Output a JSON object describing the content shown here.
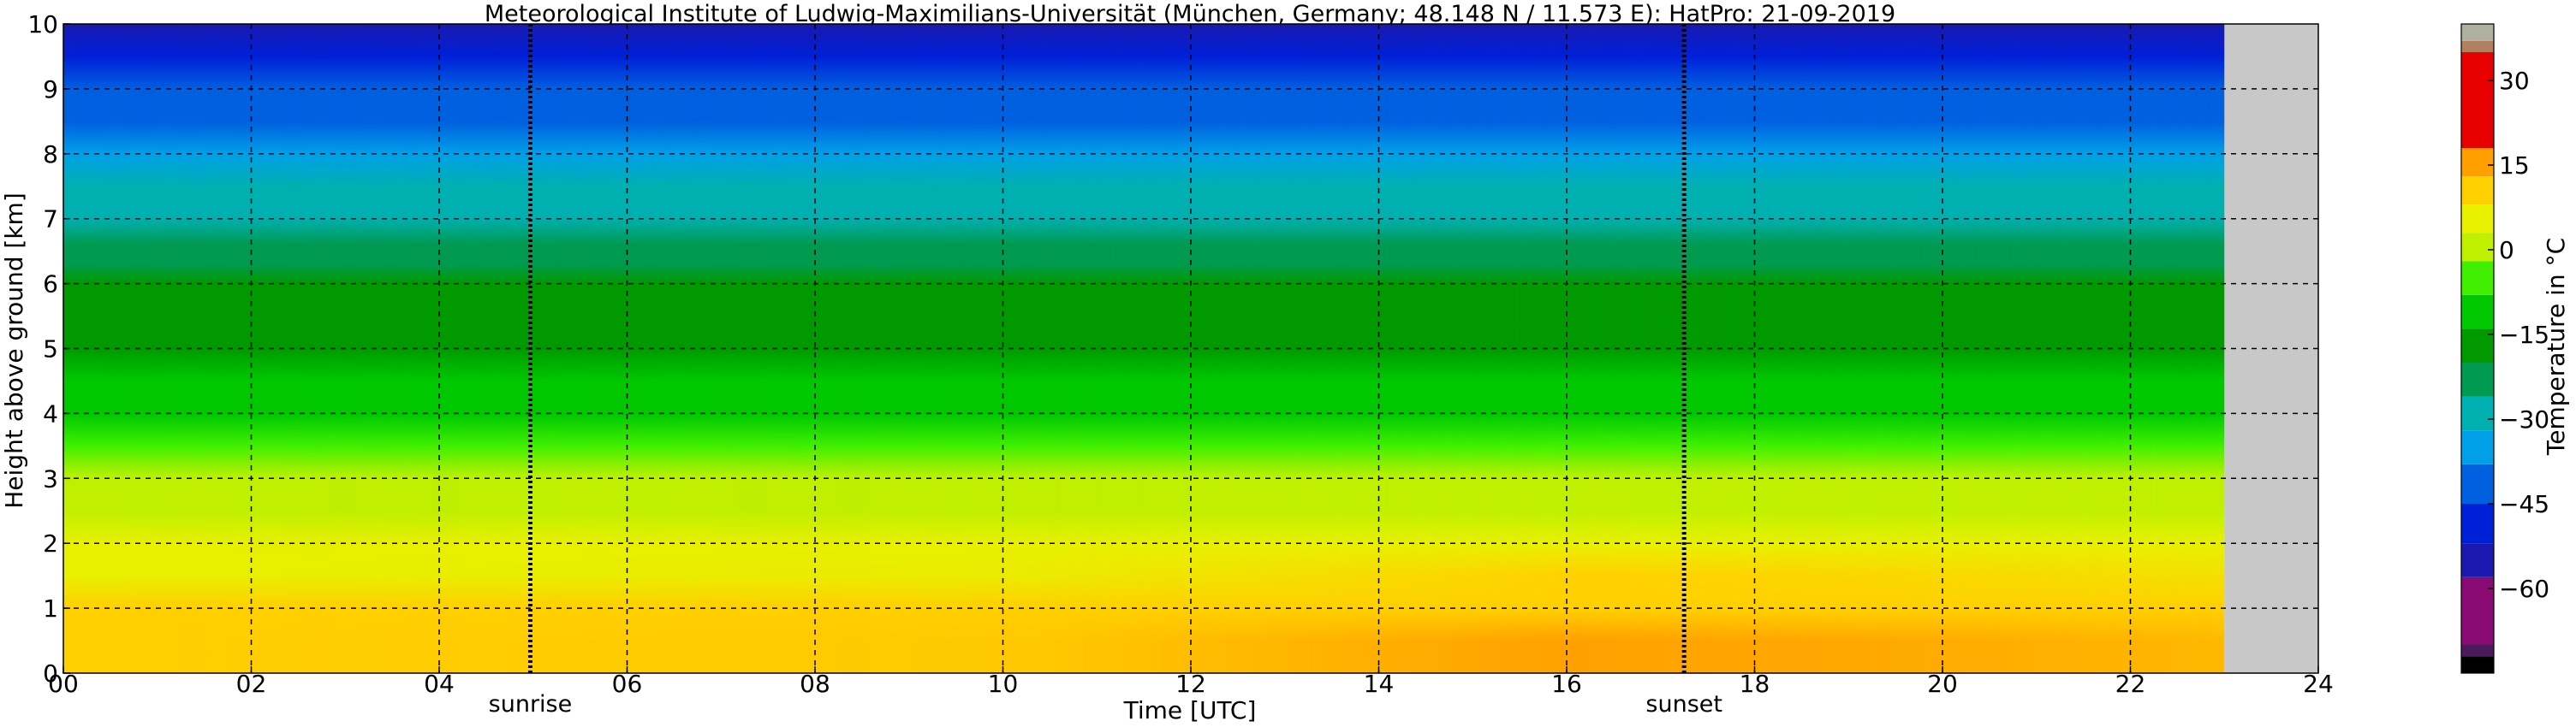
{
  "chart_data": {
    "type": "heatmap",
    "title": "Meteorological Institute of Ludwig-Maximilians-Universität (München, Germany; 48.148 N / 11.573 E):    HatPro: 21-09-2019",
    "xlabel": "Time [UTC]",
    "ylabel": "Height above ground [km]",
    "xlim": [
      0,
      24
    ],
    "ylim": [
      0,
      10
    ],
    "x_ticks": [
      "00",
      "02",
      "04",
      "06",
      "08",
      "10",
      "12",
      "14",
      "16",
      "18",
      "20",
      "22",
      "24"
    ],
    "y_ticks": [
      "0",
      "1",
      "2",
      "3",
      "4",
      "5",
      "6",
      "7",
      "8",
      "9",
      "10"
    ],
    "grid": true,
    "data_end_time": 23.0,
    "sunrise": {
      "time": 4.97,
      "label": "sunrise"
    },
    "sunset": {
      "time": 17.25,
      "label": "sunset"
    },
    "colorbar": {
      "label": "Temperature in °C",
      "range": [
        -75,
        40
      ],
      "ticks": [
        "30",
        "15",
        "0",
        "−15",
        "−30",
        "−45",
        "−60"
      ],
      "tick_values": [
        30,
        15,
        0,
        -15,
        -30,
        -45,
        -60
      ],
      "bands": [
        {
          "from": -75,
          "to": -72,
          "color": "#000000"
        },
        {
          "from": -72,
          "to": -70,
          "color": "#4a1a5a"
        },
        {
          "from": -70,
          "to": -58,
          "color": "#8a0a73"
        },
        {
          "from": -58,
          "to": -52,
          "color": "#1a1ab0"
        },
        {
          "from": -52,
          "to": -45,
          "color": "#0020d8"
        },
        {
          "from": -45,
          "to": -38,
          "color": "#0060e0"
        },
        {
          "from": -38,
          "to": -32,
          "color": "#00a0e8"
        },
        {
          "from": -32,
          "to": -26,
          "color": "#00b0b0"
        },
        {
          "from": -26,
          "to": -20,
          "color": "#009a50"
        },
        {
          "from": -20,
          "to": -14,
          "color": "#009a00"
        },
        {
          "from": -14,
          "to": -8,
          "color": "#00c800"
        },
        {
          "from": -8,
          "to": -2,
          "color": "#40f000"
        },
        {
          "from": -2,
          "to": 3,
          "color": "#c0f000"
        },
        {
          "from": 3,
          "to": 8,
          "color": "#e8f000"
        },
        {
          "from": 8,
          "to": 13,
          "color": "#ffd000"
        },
        {
          "from": 13,
          "to": 18,
          "color": "#ffa000"
        },
        {
          "from": 18,
          "to": 35,
          "color": "#e80000"
        },
        {
          "from": 35,
          "to": 37,
          "color": "#b08060"
        },
        {
          "from": 37,
          "to": 40,
          "color": "#b0b0a0"
        }
      ]
    },
    "temperature_profiles": [
      {
        "period": "00-12",
        "height_km": [
          0,
          0.5,
          1,
          1.5,
          2,
          2.5,
          3,
          3.5,
          4,
          4.5,
          5,
          5.5,
          6,
          6.3,
          6.6,
          7,
          7.5,
          8,
          8.5,
          9,
          9.5,
          10
        ],
        "temperature_c": [
          12,
          11,
          9,
          7,
          5,
          2,
          -2,
          -6,
          -9,
          -12,
          -15,
          -17,
          -19,
          -21,
          -26,
          -29,
          -32,
          -36,
          -40,
          -45,
          -50,
          -54
        ]
      },
      {
        "period": "12-23",
        "height_km": [
          0,
          0.5,
          1,
          1.5,
          2,
          2.5,
          3,
          3.5,
          4,
          4.5,
          5,
          5.5,
          6,
          6.3,
          6.6,
          7,
          7.5,
          8,
          8.5,
          9,
          9.5,
          10
        ],
        "temperature_c": [
          17,
          14,
          11,
          8,
          5,
          2,
          -2,
          -6,
          -9,
          -12,
          -15,
          -17,
          -19,
          -21,
          -26,
          -29,
          -32,
          -36,
          -40,
          -45,
          -50,
          -54
        ]
      }
    ],
    "missing_data_color": "#c8c8c8"
  }
}
